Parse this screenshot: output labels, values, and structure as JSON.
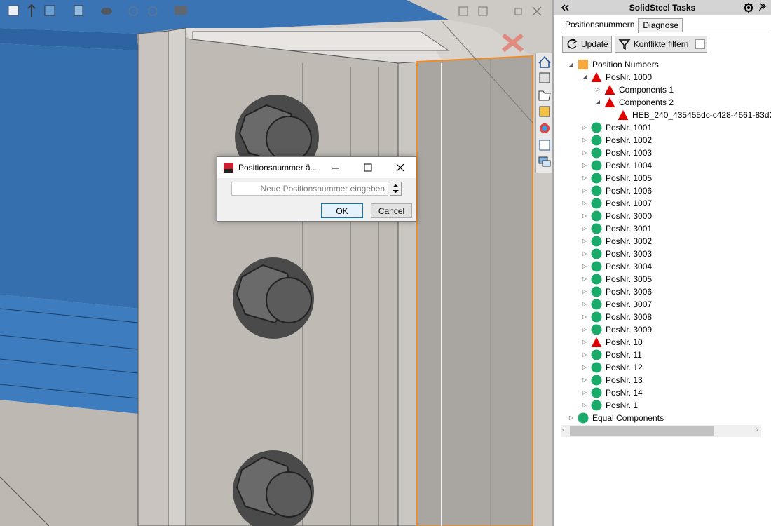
{
  "panel": {
    "title": "SolidSteel Tasks",
    "collapse_icon": "double-chevron-left-icon",
    "tabs": [
      {
        "label": "Positionsnummern",
        "active": true
      },
      {
        "label": "Diagnose",
        "active": false
      }
    ],
    "toolbar": {
      "update_label": "Update",
      "filter_label": "Konflikte filtern"
    },
    "tree": [
      {
        "label": "Position Numbers",
        "icon": "orange-square",
        "level": 0,
        "expander": "expanded"
      },
      {
        "label": "PosNr. 1000",
        "icon": "red-triangle",
        "level": 1,
        "expander": "expanded"
      },
      {
        "label": "Components 1",
        "icon": "red-triangle",
        "level": 2,
        "expander": "collapsed"
      },
      {
        "label": "Components 2",
        "icon": "red-triangle",
        "level": 2,
        "expander": "expanded"
      },
      {
        "label": "HEB_240_435455dc-c428-4661-83d2",
        "icon": "red-triangle",
        "level": 3,
        "expander": "none"
      },
      {
        "label": "PosNr. 1001",
        "icon": "green-circle",
        "level": 1,
        "expander": "collapsed"
      },
      {
        "label": "PosNr. 1002",
        "icon": "green-circle",
        "level": 1,
        "expander": "collapsed"
      },
      {
        "label": "PosNr. 1003",
        "icon": "green-circle",
        "level": 1,
        "expander": "collapsed"
      },
      {
        "label": "PosNr. 1004",
        "icon": "green-circle",
        "level": 1,
        "expander": "collapsed"
      },
      {
        "label": "PosNr. 1005",
        "icon": "green-circle",
        "level": 1,
        "expander": "collapsed"
      },
      {
        "label": "PosNr. 1006",
        "icon": "green-circle",
        "level": 1,
        "expander": "collapsed"
      },
      {
        "label": "PosNr. 1007",
        "icon": "green-circle",
        "level": 1,
        "expander": "collapsed"
      },
      {
        "label": "PosNr. 3000",
        "icon": "green-circle",
        "level": 1,
        "expander": "collapsed"
      },
      {
        "label": "PosNr. 3001",
        "icon": "green-circle",
        "level": 1,
        "expander": "collapsed"
      },
      {
        "label": "PosNr. 3002",
        "icon": "green-circle",
        "level": 1,
        "expander": "collapsed"
      },
      {
        "label": "PosNr. 3003",
        "icon": "green-circle",
        "level": 1,
        "expander": "collapsed"
      },
      {
        "label": "PosNr. 3004",
        "icon": "green-circle",
        "level": 1,
        "expander": "collapsed"
      },
      {
        "label": "PosNr. 3005",
        "icon": "green-circle",
        "level": 1,
        "expander": "collapsed"
      },
      {
        "label": "PosNr. 3006",
        "icon": "green-circle",
        "level": 1,
        "expander": "collapsed"
      },
      {
        "label": "PosNr. 3007",
        "icon": "green-circle",
        "level": 1,
        "expander": "collapsed"
      },
      {
        "label": "PosNr. 3008",
        "icon": "green-circle",
        "level": 1,
        "expander": "collapsed"
      },
      {
        "label": "PosNr. 3009",
        "icon": "green-circle",
        "level": 1,
        "expander": "collapsed"
      },
      {
        "label": "PosNr. 10",
        "icon": "red-triangle",
        "level": 1,
        "expander": "collapsed"
      },
      {
        "label": "PosNr. 11",
        "icon": "green-circle",
        "level": 1,
        "expander": "collapsed"
      },
      {
        "label": "PosNr. 12",
        "icon": "green-circle",
        "level": 1,
        "expander": "collapsed"
      },
      {
        "label": "PosNr. 13",
        "icon": "green-circle",
        "level": 1,
        "expander": "collapsed"
      },
      {
        "label": "PosNr. 14",
        "icon": "green-circle",
        "level": 1,
        "expander": "collapsed"
      },
      {
        "label": "PosNr. 1",
        "icon": "green-circle",
        "level": 1,
        "expander": "collapsed"
      },
      {
        "label": "Equal Components",
        "icon": "green-circle",
        "level": 0,
        "expander": "collapsed"
      }
    ]
  },
  "dialog": {
    "title": "Positionsnummer ä...",
    "input_placeholder": "Neue Positionsnummer eingeben",
    "ok_label": "OK",
    "cancel_label": "Cancel"
  },
  "colors": {
    "green": "#1aaa6a",
    "red": "#e00000",
    "orange": "#f7a83d",
    "steel_blue": "#3d78b8",
    "accent_orange": "#f08a24"
  }
}
